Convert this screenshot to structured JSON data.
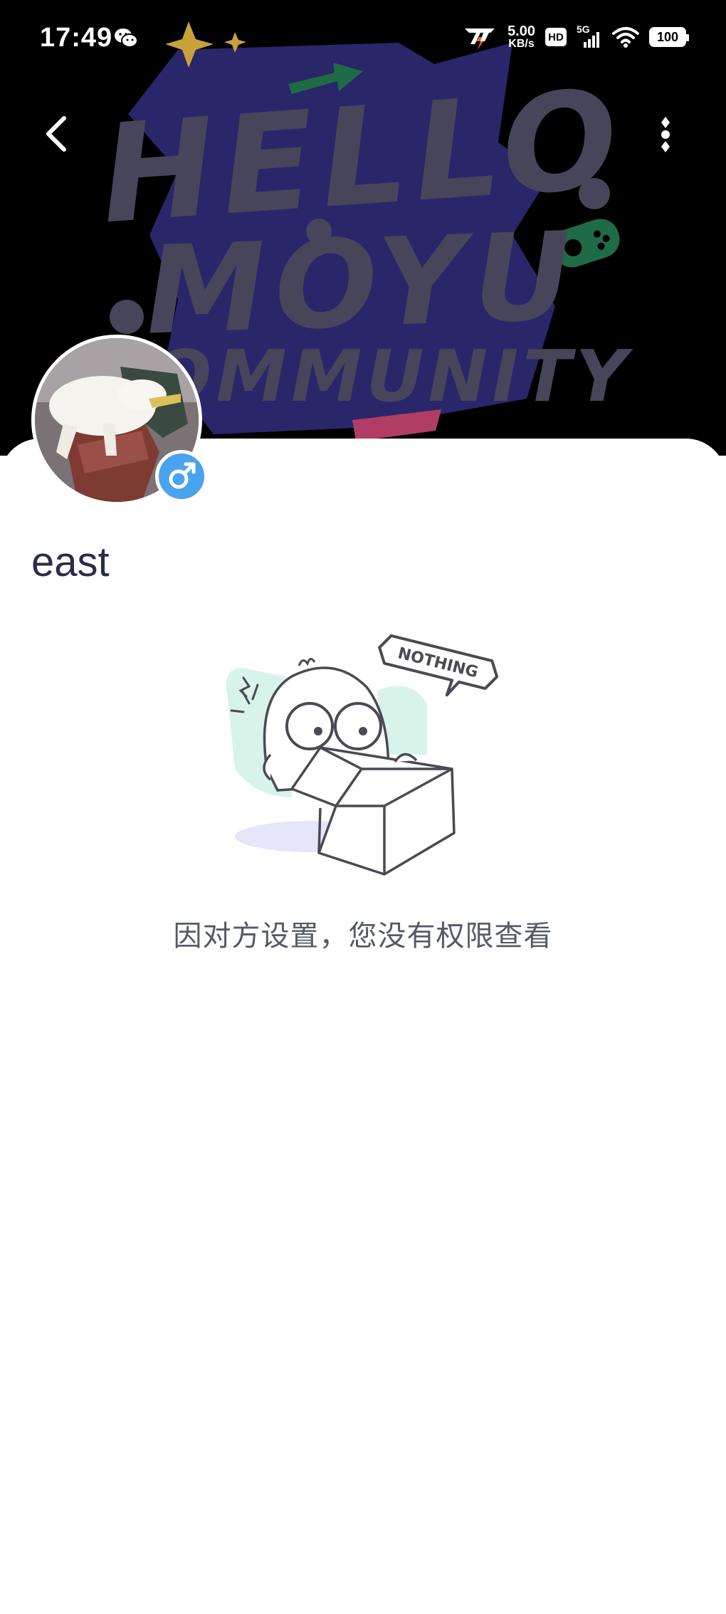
{
  "status_bar": {
    "time": "17:49",
    "net_speed_value": "5.00",
    "net_speed_unit": "KB/s",
    "hd_label": "HD",
    "network_label": "5G",
    "battery": "100",
    "icons": [
      "wechat-icon",
      "speed-app-icon",
      "hd-icon",
      "signal-icon",
      "wifi-icon",
      "battery-icon"
    ]
  },
  "banner": {
    "line1": "HELLO",
    "line2": "MOYU",
    "line3": "COMMUNITY",
    "colors": {
      "background": "#000000",
      "text": "#47455a",
      "shape": "#29266a",
      "green": "#1f6b45",
      "gold": "#c9a13a",
      "pink": "#b23d64"
    }
  },
  "nav": {
    "back_icon": "chevron-left-icon",
    "more_icon": "more-vertical-icon"
  },
  "profile": {
    "username": "east",
    "gender": "male",
    "gender_icon": "male-icon",
    "badge_color": "#4aa3ee"
  },
  "empty_state": {
    "bubble_text": "NOTHING",
    "message": "因对方设置，您没有权限查看"
  }
}
